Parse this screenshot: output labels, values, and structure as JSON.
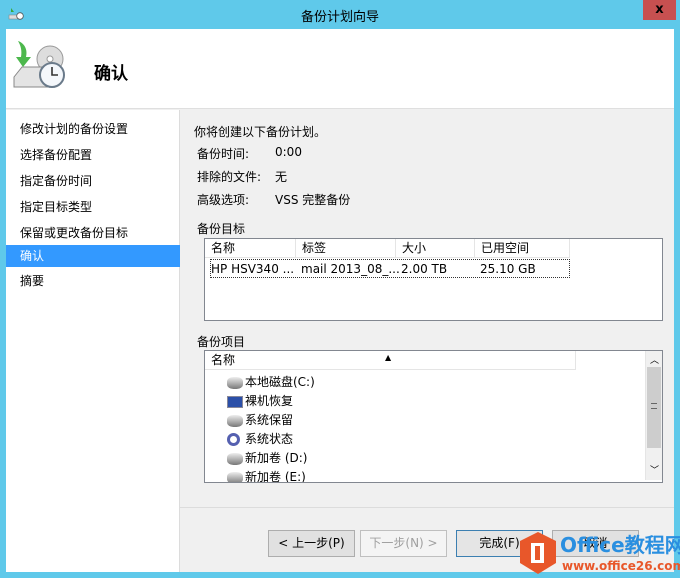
{
  "window": {
    "title": "备份计划向导",
    "close_glyph": "x"
  },
  "header": {
    "title": "确认",
    "icon": "backup-schedule-icon"
  },
  "sidebar": {
    "items": [
      {
        "label": "修改计划的备份设置",
        "selected": false
      },
      {
        "label": "选择备份配置",
        "selected": false
      },
      {
        "label": "指定备份时间",
        "selected": false
      },
      {
        "label": "指定目标类型",
        "selected": false
      },
      {
        "label": "保留或更改备份目标",
        "selected": false
      },
      {
        "label": "确认",
        "selected": true
      },
      {
        "label": "摘要",
        "selected": false
      }
    ],
    "selected_color": "#3399ff"
  },
  "summary": {
    "intro": "你将创建以下备份计划。",
    "rows": [
      {
        "label": "备份时间:",
        "value": "0:00"
      },
      {
        "label": "排除的文件:",
        "value": "无"
      },
      {
        "label": "高级选项:",
        "value": "VSS 完整备份"
      }
    ]
  },
  "target": {
    "title": "备份目标",
    "columns": [
      "名称",
      "标签",
      "大小",
      "已用空间"
    ],
    "rows": [
      [
        "HP HSV340 ...",
        "mail 2013_08_...",
        "2.00 TB",
        "25.10 GB"
      ]
    ]
  },
  "items": {
    "title": "备份项目",
    "column": "名称",
    "rows": [
      {
        "label": "本地磁盘(C:)",
        "icon": "drive-icon"
      },
      {
        "label": "裸机恢复",
        "icon": "computer-icon"
      },
      {
        "label": "系统保留",
        "icon": "drive-icon"
      },
      {
        "label": "系统状态",
        "icon": "gear-icon"
      },
      {
        "label": "新加卷 (D:)",
        "icon": "drive-icon"
      },
      {
        "label": "新加卷 (E:)",
        "icon": "drive-icon"
      }
    ]
  },
  "buttons": {
    "prev": "< 上一步(P)",
    "next": "下一步(N) >",
    "finish": "完成(F)",
    "cancel": "取消"
  },
  "watermark": {
    "brand": "Office教程网",
    "url": "www.office26.com",
    "color": "#e8572a"
  }
}
